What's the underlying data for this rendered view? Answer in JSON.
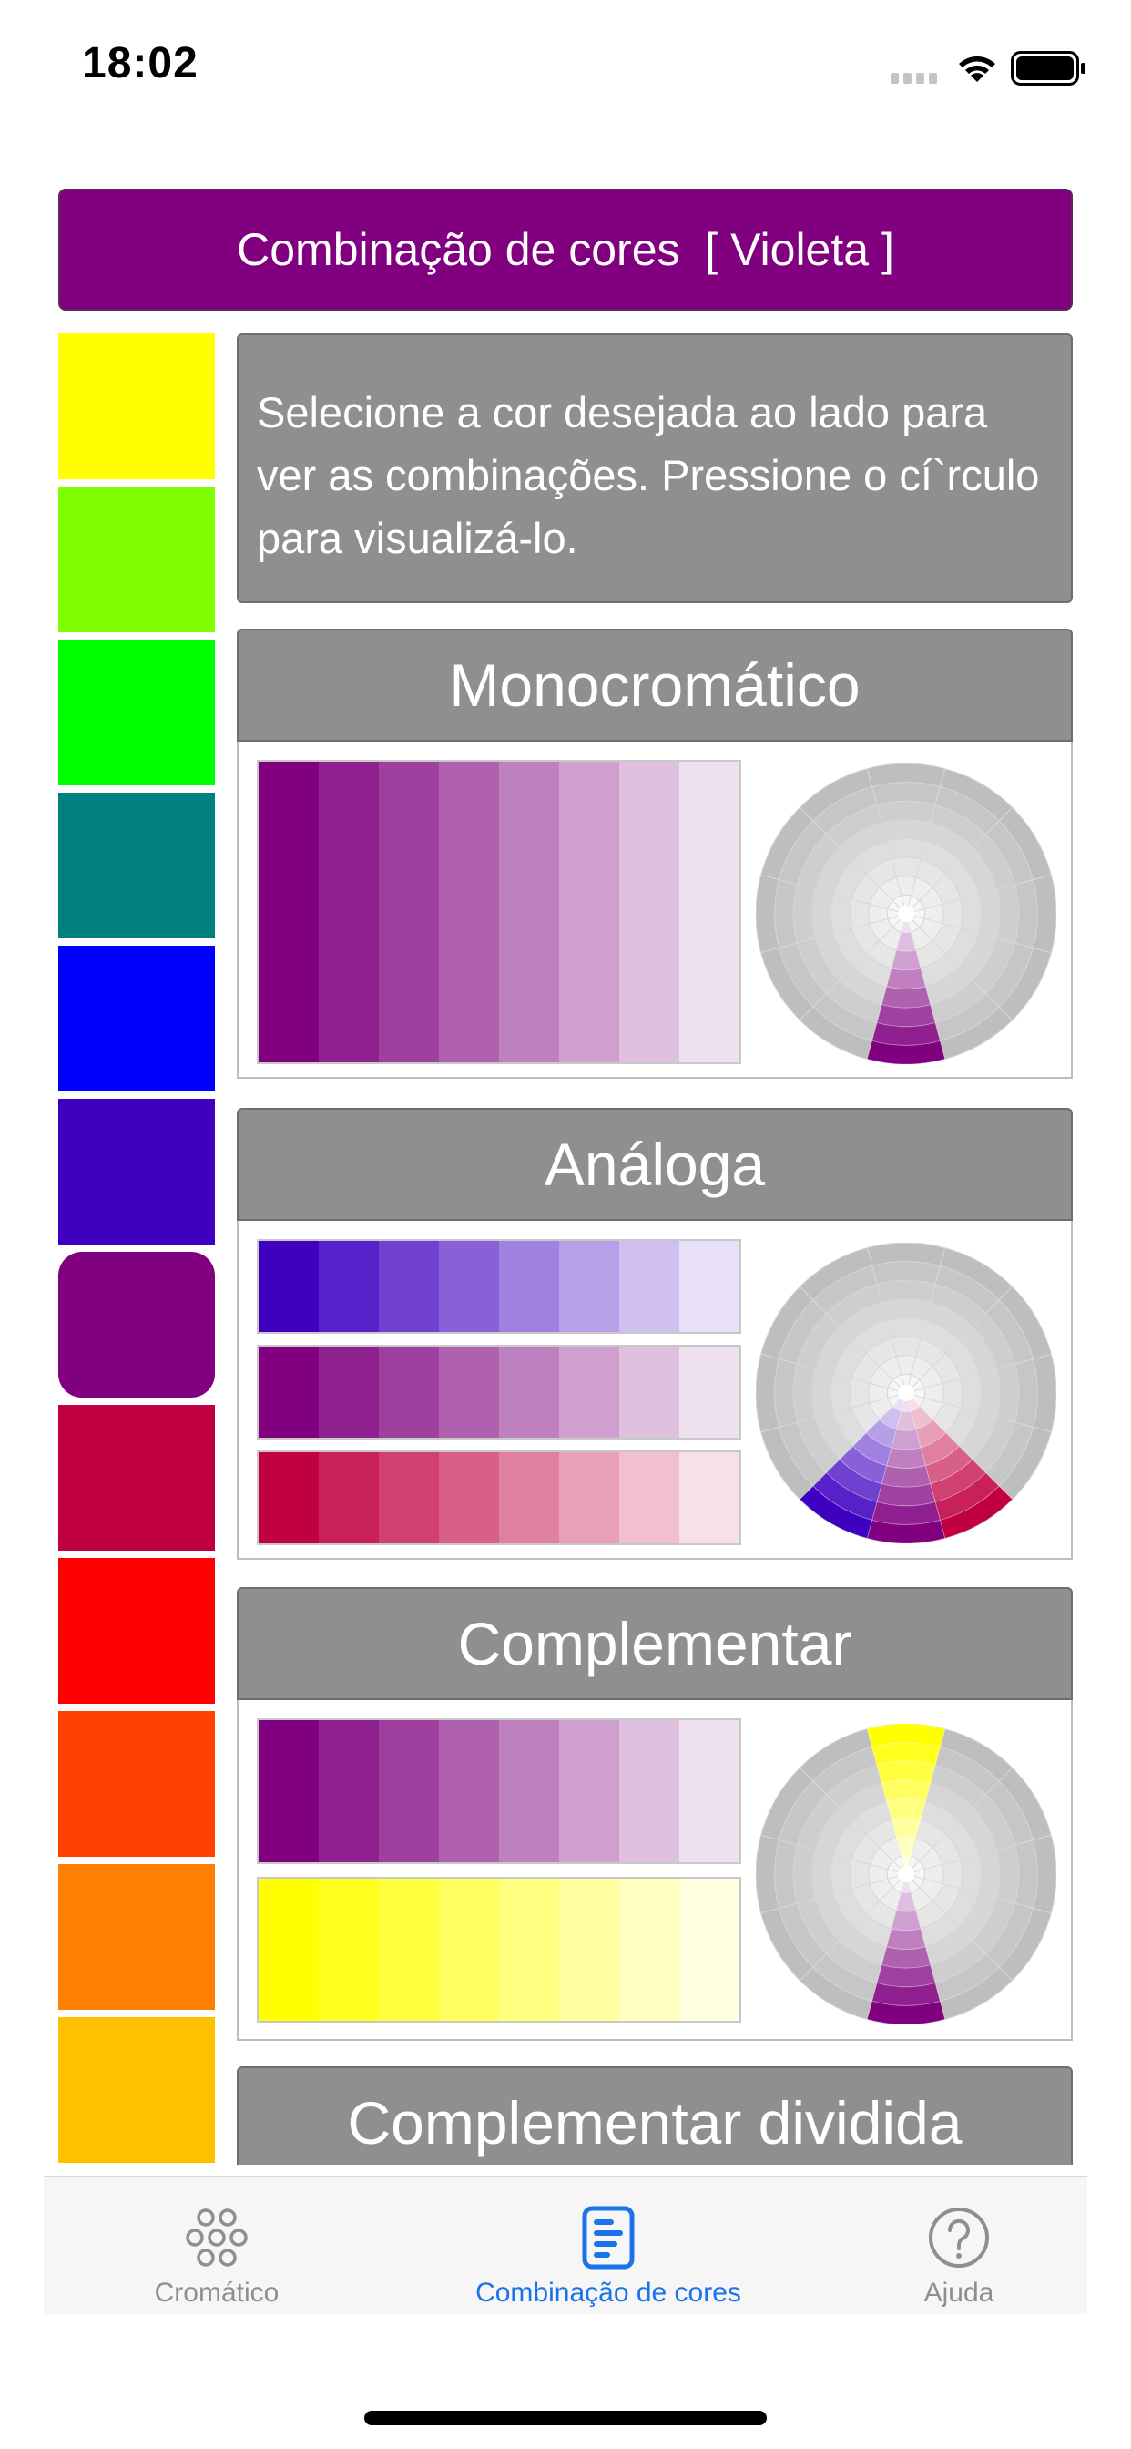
{
  "status_bar": {
    "time": "18:02"
  },
  "header": {
    "title": "Combinação de cores  [ Violeta ]"
  },
  "swatches": [
    {
      "name": "swatch-yellow",
      "color": "#FFFF00"
    },
    {
      "name": "swatch-yellow-green",
      "color": "#80FF00"
    },
    {
      "name": "swatch-green",
      "color": "#00FF00"
    },
    {
      "name": "swatch-teal",
      "color": "#008080"
    },
    {
      "name": "swatch-blue",
      "color": "#0000FF"
    },
    {
      "name": "swatch-blue-violet",
      "color": "#4000C0"
    },
    {
      "name": "swatch-violet",
      "color": "#800080",
      "selected": true
    },
    {
      "name": "swatch-red-violet",
      "color": "#C00040"
    },
    {
      "name": "swatch-red",
      "color": "#FF0000"
    },
    {
      "name": "swatch-red-orange",
      "color": "#FF4000"
    },
    {
      "name": "swatch-orange",
      "color": "#FF8000"
    },
    {
      "name": "swatch-yellow-orange",
      "color": "#FFC000"
    }
  ],
  "instructions": {
    "text": "Selecione a cor desejada ao lado para ver as combinações. Pressione o cí`rculo para visualizá-lo."
  },
  "sections": [
    {
      "title": "Monocromático",
      "strips": [
        [
          "#800080",
          "#8F208F",
          "#9F409F",
          "#AF60AF",
          "#BF80BF",
          "#CFA0CF",
          "#DFC0DF",
          "#EFE0EF"
        ]
      ],
      "wheel_hues": [
        "#800080"
      ]
    },
    {
      "title": "Análoga",
      "strips": [
        [
          "#4000C0",
          "#5820C8",
          "#7040D0",
          "#8860D8",
          "#A080E0",
          "#B8A0E8",
          "#D0C0F0",
          "#E8E0F8"
        ],
        [
          "#800080",
          "#8F208F",
          "#9F409F",
          "#AF60AF",
          "#BF80BF",
          "#CFA0CF",
          "#DFC0DF",
          "#EFE0EF"
        ],
        [
          "#C00040",
          "#C82058",
          "#D04070",
          "#D86088",
          "#E080A0",
          "#E8A0B8",
          "#F0C0D0",
          "#F8E0E8"
        ]
      ],
      "wheel_hues": [
        "#C00040",
        "#800080",
        "#4000C0"
      ]
    },
    {
      "title": "Complementar",
      "strips": [
        [
          "#800080",
          "#8F208F",
          "#9F409F",
          "#AF60AF",
          "#BF80BF",
          "#CFA0CF",
          "#DFC0DF",
          "#EFE0EF"
        ],
        [
          "#FFFF00",
          "#FFFF20",
          "#FFFF40",
          "#FFFF60",
          "#FFFF80",
          "#FFFFA0",
          "#FFFFC0",
          "#FFFFE0"
        ]
      ],
      "wheel_hues": [
        "#800080",
        "#FFFF00"
      ]
    },
    {
      "title": "Complementar dividida",
      "strips": [],
      "wheel_hues": []
    }
  ],
  "tabbar": {
    "tabs": [
      {
        "label": "Cromático",
        "icon": "flower-circles-icon",
        "active": false
      },
      {
        "label": "Combinação de cores",
        "icon": "document-list-icon",
        "active": true
      },
      {
        "label": "Ajuda",
        "icon": "question-circle-icon",
        "active": false
      }
    ]
  },
  "colors": {
    "accent": "#1A73E8",
    "header_bg": "#800080",
    "section_bg": "#8F8F8F"
  }
}
